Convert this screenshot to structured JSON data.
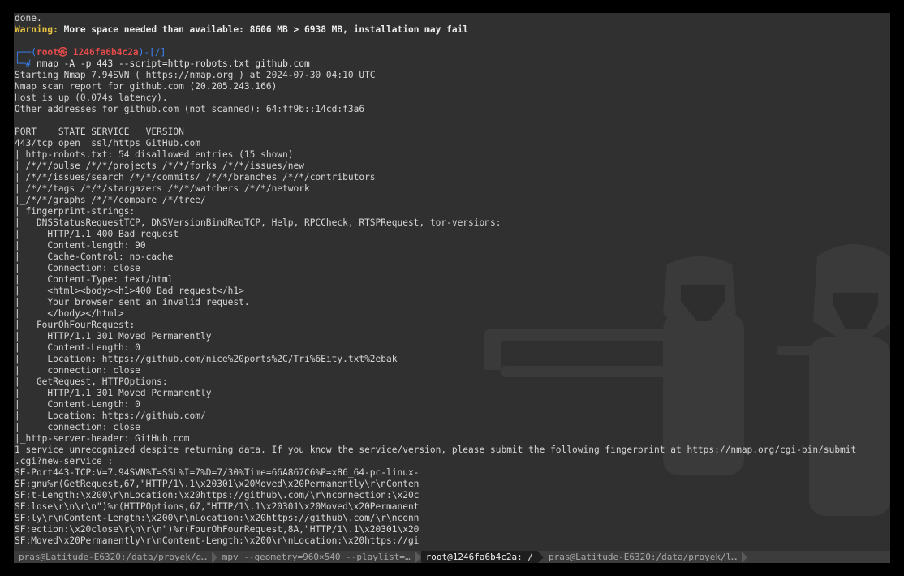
{
  "terminal": {
    "line1": "done.",
    "warning_label": "Warning:",
    "warning_text": " More space needed than available: 8606 MB > 6938 MB, installation may fail",
    "prompt": {
      "frame_left": "┌──(",
      "user_host": "root㉿ 1246fa6b4c2a",
      "frame_right": ")-[/]",
      "corner": "└─",
      "hash": "# ",
      "command": "nmap -A -p 443 --script=http-robots.txt github.com"
    },
    "output": [
      "Starting Nmap 7.94SVN ( https://nmap.org ) at 2024-07-30 04:10 UTC",
      "Nmap scan report for github.com (20.205.243.166)",
      "Host is up (0.074s latency).",
      "Other addresses for github.com (not scanned): 64:ff9b::14cd:f3a6",
      "",
      "PORT    STATE SERVICE   VERSION",
      "443/tcp open  ssl/https GitHub.com",
      "| http-robots.txt: 54 disallowed entries (15 shown)",
      "| /*/*/pulse /*/*/projects /*/*/forks /*/*/issues/new",
      "| /*/*/issues/search /*/*/commits/ /*/*/branches /*/*/contributors",
      "| /*/*/tags /*/*/stargazers /*/*/watchers /*/*/network",
      "|_/*/*/graphs /*/*/compare /*/tree/",
      "| fingerprint-strings:",
      "|   DNSStatusRequestTCP, DNSVersionBindReqTCP, Help, RPCCheck, RTSPRequest, tor-versions:",
      "|     HTTP/1.1 400 Bad request",
      "|     Content-length: 90",
      "|     Cache-Control: no-cache",
      "|     Connection: close",
      "|     Content-Type: text/html",
      "|     <html><body><h1>400 Bad request</h1>",
      "|     Your browser sent an invalid request.",
      "|     </body></html>",
      "|   FourOhFourRequest:",
      "|     HTTP/1.1 301 Moved Permanently",
      "|     Content-Length: 0",
      "|     Location: https://github.com/nice%20ports%2C/Tri%6Eity.txt%2ebak",
      "|     connection: close",
      "|   GetRequest, HTTPOptions:",
      "|     HTTP/1.1 301 Moved Permanently",
      "|     Content-Length: 0",
      "|     Location: https://github.com/",
      "|_    connection: close",
      "|_http-server-header: GitHub.com",
      "1 service unrecognized despite returning data. If you know the service/version, please submit the following fingerprint at https://nmap.org/cgi-bin/submit",
      ".cgi?new-service :",
      "SF-Port443-TCP:V=7.94SVN%T=SSL%I=7%D=7/30%Time=66A867C6%P=x86_64-pc-linux-",
      "SF:gnu%r(GetRequest,67,\"HTTP/1\\.1\\x20301\\x20Moved\\x20Permanently\\r\\nConten",
      "SF:t-Length:\\x200\\r\\nLocation:\\x20https://github\\.com/\\r\\nconnection:\\x20c",
      "SF:lose\\r\\n\\r\\n\")%r(HTTPOptions,67,\"HTTP/1\\.1\\x20301\\x20Moved\\x20Permanent",
      "SF:ly\\r\\nContent-Length:\\x200\\r\\nLocation:\\x20https://github\\.com/\\r\\nconn",
      "SF:ection:\\x20close\\r\\n\\r\\n\")%r(FourOhFourRequest,8A,\"HTTP/1\\.1\\x20301\\x20",
      "SF:Moved\\x20Permanently\\r\\nContent-Length:\\x200\\r\\nLocation:\\x20https://gi"
    ]
  },
  "tabs": [
    {
      "label": "pras@Latitude-E6320:/data/proyek/g…",
      "active": false
    },
    {
      "label": "mpv --geometry=960×540 --playlist=…",
      "active": false
    },
    {
      "label": "root@1246fa6b4c2a: /",
      "active": true
    },
    {
      "label": "pras@Latitude-E6320:/data/proyek/l…",
      "active": false
    }
  ],
  "colors": {
    "terminal_bg": "#303030",
    "warning": "#e8c441",
    "prompt_frame": "#3b82f6",
    "root_user": "#e34a4a"
  }
}
